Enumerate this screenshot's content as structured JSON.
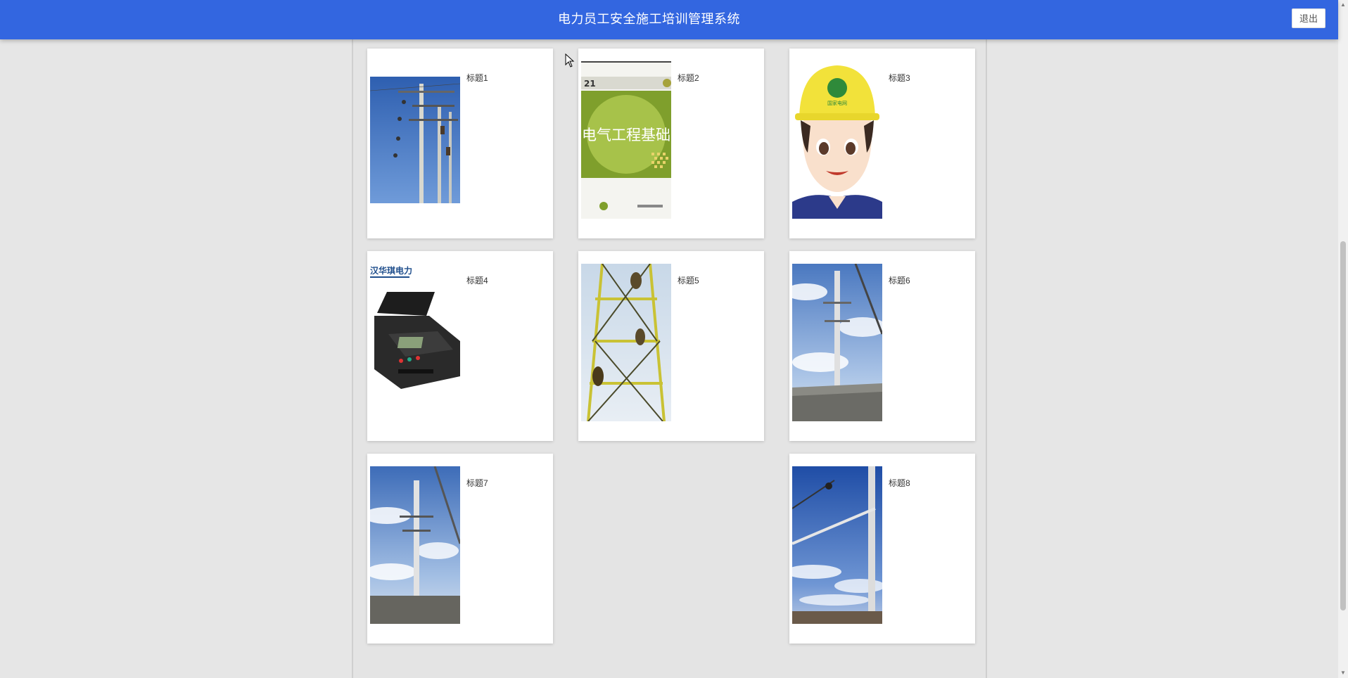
{
  "header": {
    "title": "电力员工安全施工培训管理系统",
    "logout_label": "退出",
    "bg_color": "#3366e0"
  },
  "cards": [
    {
      "title": "标题1",
      "image": "power-pole-workers-image"
    },
    {
      "title": "标题2",
      "image": "book-cover-image",
      "book_series": "21",
      "book_title": "电气工程基础"
    },
    {
      "title": "标题3",
      "image": "cartoon-worker-helmet-image",
      "helmet_text": "国家电网"
    },
    {
      "title": "标题4",
      "image": "electrical-tester-case-image",
      "brand": "汉华琪电力"
    },
    {
      "title": "标题5",
      "image": "steel-tower-climbers-image"
    },
    {
      "title": "标题6",
      "image": "crane-power-pole-image"
    },
    {
      "title": "标题7",
      "image": "crane-power-pole-image-2"
    },
    {
      "title": "标题8",
      "image": "power-pole-crossarm-image"
    }
  ]
}
